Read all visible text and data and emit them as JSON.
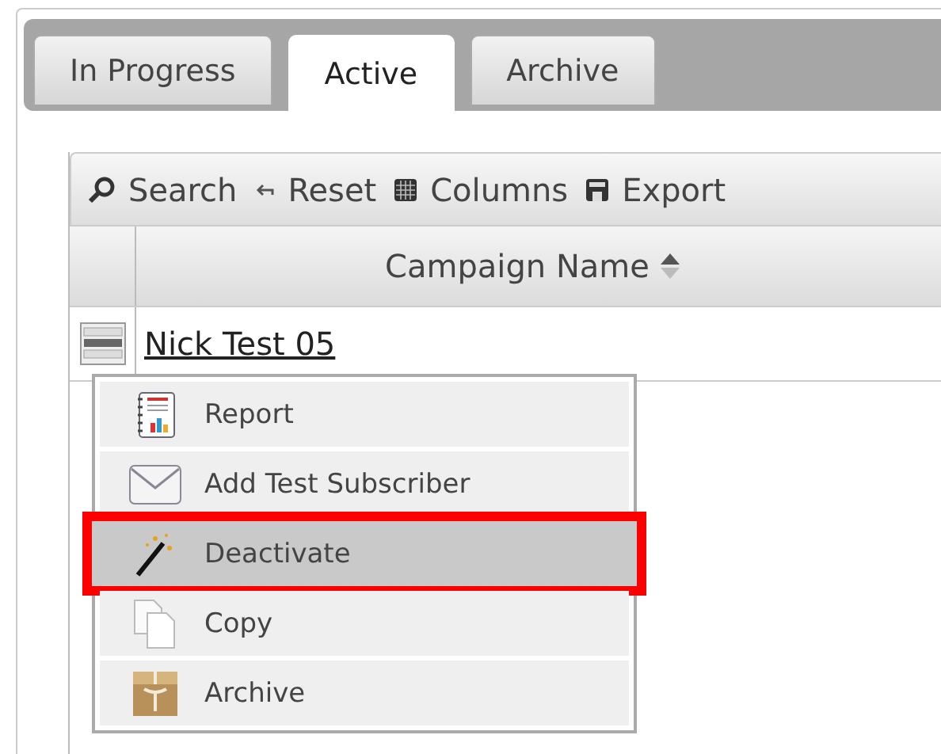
{
  "tabs": [
    {
      "label": "In Progress",
      "selected": false
    },
    {
      "label": "Active",
      "selected": true
    },
    {
      "label": "Archive",
      "selected": false
    }
  ],
  "toolbar": [
    {
      "kind": "search",
      "label": "Search"
    },
    {
      "kind": "reset",
      "label": "Reset"
    },
    {
      "kind": "columns",
      "label": "Columns"
    },
    {
      "kind": "export",
      "label": "Export"
    }
  ],
  "table": {
    "columns": [
      "Campaign Name"
    ],
    "rows": [
      {
        "campaign_name": "Nick Test 05"
      }
    ]
  },
  "context_menu": [
    {
      "kind": "report",
      "label": "Report",
      "highlighted": false
    },
    {
      "kind": "mail",
      "label": "Add Test Subscriber",
      "highlighted": false
    },
    {
      "kind": "wand",
      "label": "Deactivate",
      "highlighted": true
    },
    {
      "kind": "copy",
      "label": "Copy",
      "highlighted": false
    },
    {
      "kind": "archive",
      "label": "Archive",
      "highlighted": false
    }
  ]
}
